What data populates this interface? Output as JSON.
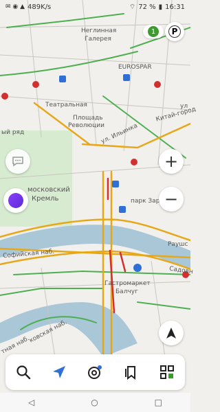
{
  "statusbar": {
    "speed": "489K/s",
    "battery": "72 %",
    "time": "16:31"
  },
  "map": {
    "labels": {
      "neglinnaya": "Неглинная",
      "galereya": "Галерея",
      "eurospar": "EUROSPAR",
      "teatralnaya": "Театральная",
      "ploshchad": "Площадь",
      "revolyutsii": "Революции",
      "ilyinka": "ул. Ильинка",
      "kitay_gorod": "Китай-город",
      "ul": "ул",
      "row": "ый ряд",
      "moskovsky": "московский",
      "kreml": "Кремль",
      "park": "парк Зар",
      "raush": "Раушс",
      "sofiyskaya": "Софийская наб.",
      "sadovn": "Садовн",
      "gastromarket": "Гастромаркет",
      "balchug": "Балчуг",
      "kremlevskaya": "ковская наб.",
      "naberezhnaya": "тная наб."
    }
  },
  "controls": {
    "traffic_score": "1",
    "parking_label": "P",
    "zoom_in": "+",
    "zoom_out": "−"
  },
  "bottombar": {
    "search": "search",
    "navigator": "navigator",
    "nearby": "nearby",
    "bookmarks": "bookmarks",
    "services": "services"
  }
}
